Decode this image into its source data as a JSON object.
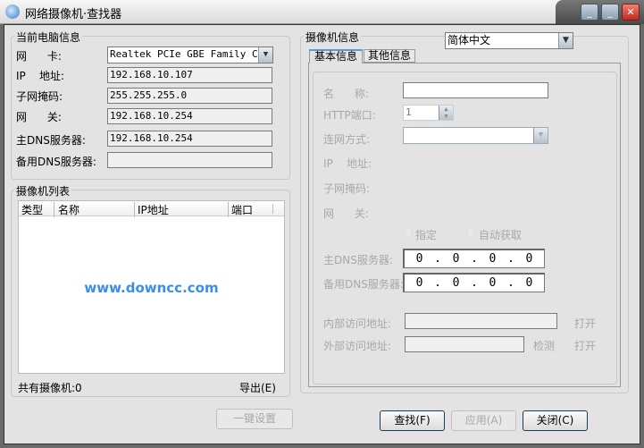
{
  "window": {
    "title": "网络摄像机·查找器",
    "minimize": "_",
    "restore": "_",
    "close": "✕"
  },
  "pc_info": {
    "title": "当前电脑信息",
    "nic_label": "网      卡:",
    "nic_value": "Realtek PCIe GBE Family Con",
    "ip_label": "IP    地址:",
    "ip_value": "192.168.10.107",
    "mask_label": "子网掩码:",
    "mask_value": "255.255.255.0",
    "gw_label": "网      关:",
    "gw_value": "192.168.10.254",
    "dns1_label": "主DNS服务器:",
    "dns1_value": "192.168.10.254",
    "dns2_label": "备用DNS服务器:",
    "dns2_value": ""
  },
  "camera_list": {
    "title": "摄像机列表",
    "columns": [
      "类型",
      "名称",
      "IP地址",
      "端口"
    ],
    "watermark": "www.downcc.com",
    "count_label": "共有摄像机:0",
    "export": "导出(E)",
    "one_key": "一键设置"
  },
  "camera_info": {
    "title": "摄像机信息",
    "language": "简体中文",
    "tabs": [
      "基本信息",
      "其他信息"
    ],
    "name_label": "名      称:",
    "name_value": "",
    "http_label": "HTTP端口:",
    "http_value": "1",
    "net_label": "连网方式:",
    "net_value": "",
    "ip_label": "IP    地址:",
    "mask_label": "子网掩码:",
    "gw_label": "网      关:",
    "radio_manual": "指定",
    "radio_auto": "自动获取",
    "dns1_label": "主DNS服务器:",
    "dns1": [
      "0",
      "0",
      "0",
      "0"
    ],
    "dns2_label": "备用DNS服务器:",
    "dns2": [
      "0",
      "0",
      "0",
      "0"
    ],
    "inner_label": "内部访问地址:",
    "inner_open": "打开",
    "outer_label": "外部访问地址:",
    "outer_check": "检测",
    "outer_open": "打开"
  },
  "buttons": {
    "find": "查找(F)",
    "apply": "应用(A)",
    "close": "关闭(C)"
  },
  "colors": {
    "watermark": "#3a8ee6"
  }
}
